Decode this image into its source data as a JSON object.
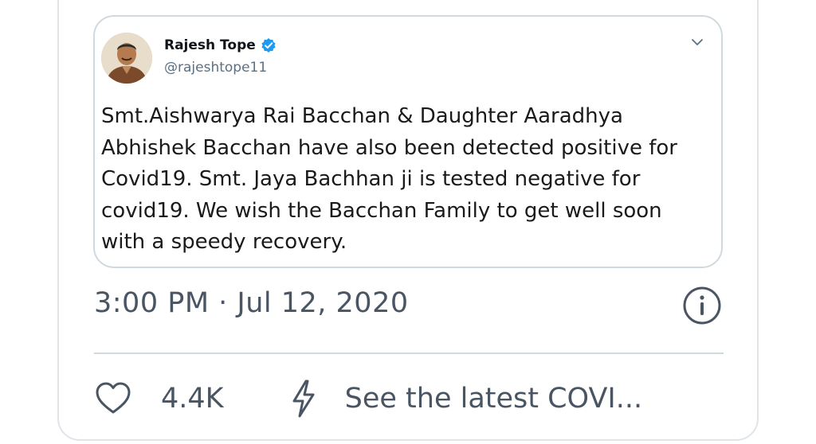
{
  "quoted_tweet": {
    "author_name": "Rajesh Tope",
    "handle": "@rajeshtope11",
    "text": "Smt.Aishwarya Rai Bacchan & Daughter Aaradhya\nAbhishek Bacchan have also been detected positive for\nCovid19. Smt. Jaya Bachhan ji is tested negative for\ncovid19. We wish the Bacchan Family to get well soon\nwith a speedy recovery.",
    "verified_icon": "verified-badge",
    "menu_icon": "chevron-down"
  },
  "timestamp": "3:00 PM · Jul 12, 2020",
  "actions": {
    "like_count": "4.4K",
    "covid_link": "See the latest COVI..."
  },
  "colors": {
    "verified": "#1d9bf0",
    "muted_text": "#4a5563",
    "border": "#cfd9de"
  }
}
